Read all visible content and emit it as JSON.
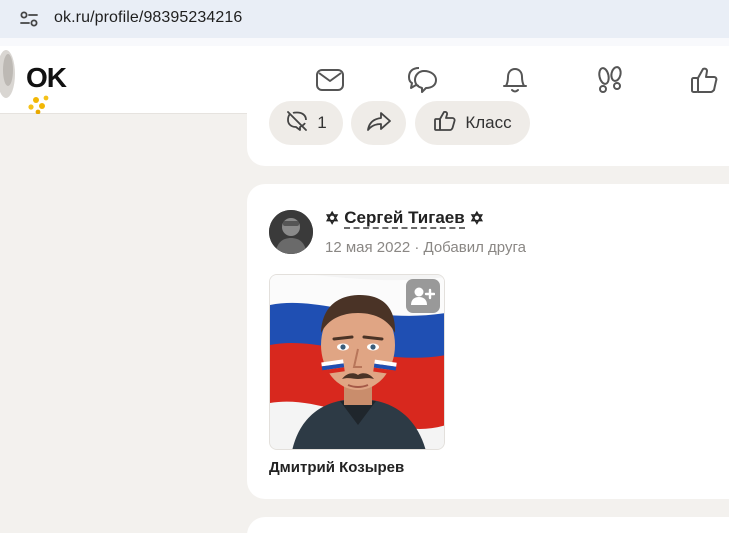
{
  "browser": {
    "url": "ok.ru/profile/98395234216",
    "site_settings_icon": "tune-icon"
  },
  "header": {
    "logo": "OK",
    "nav_icons": [
      "mail-icon",
      "chat-icon",
      "bell-icon",
      "footprints-icon",
      "like-icon"
    ]
  },
  "prev_post": {
    "comment_count": "1",
    "share_icon": "share-icon",
    "like_label": "Класс"
  },
  "post": {
    "author": "Сергей Тигаев",
    "author_decoration": "✡",
    "date": "12 мая 2022",
    "separator": "·",
    "action": "Добавил друга",
    "friend": {
      "name": "Дмитрий Козырев",
      "add_icon": "add-user-icon"
    }
  },
  "colors": {
    "page_bg": "#f3f1ee",
    "card_bg": "#ffffff",
    "pill_bg": "#efece8",
    "muted_text": "#8a8784",
    "address_bar_bg": "#e9eef6"
  }
}
